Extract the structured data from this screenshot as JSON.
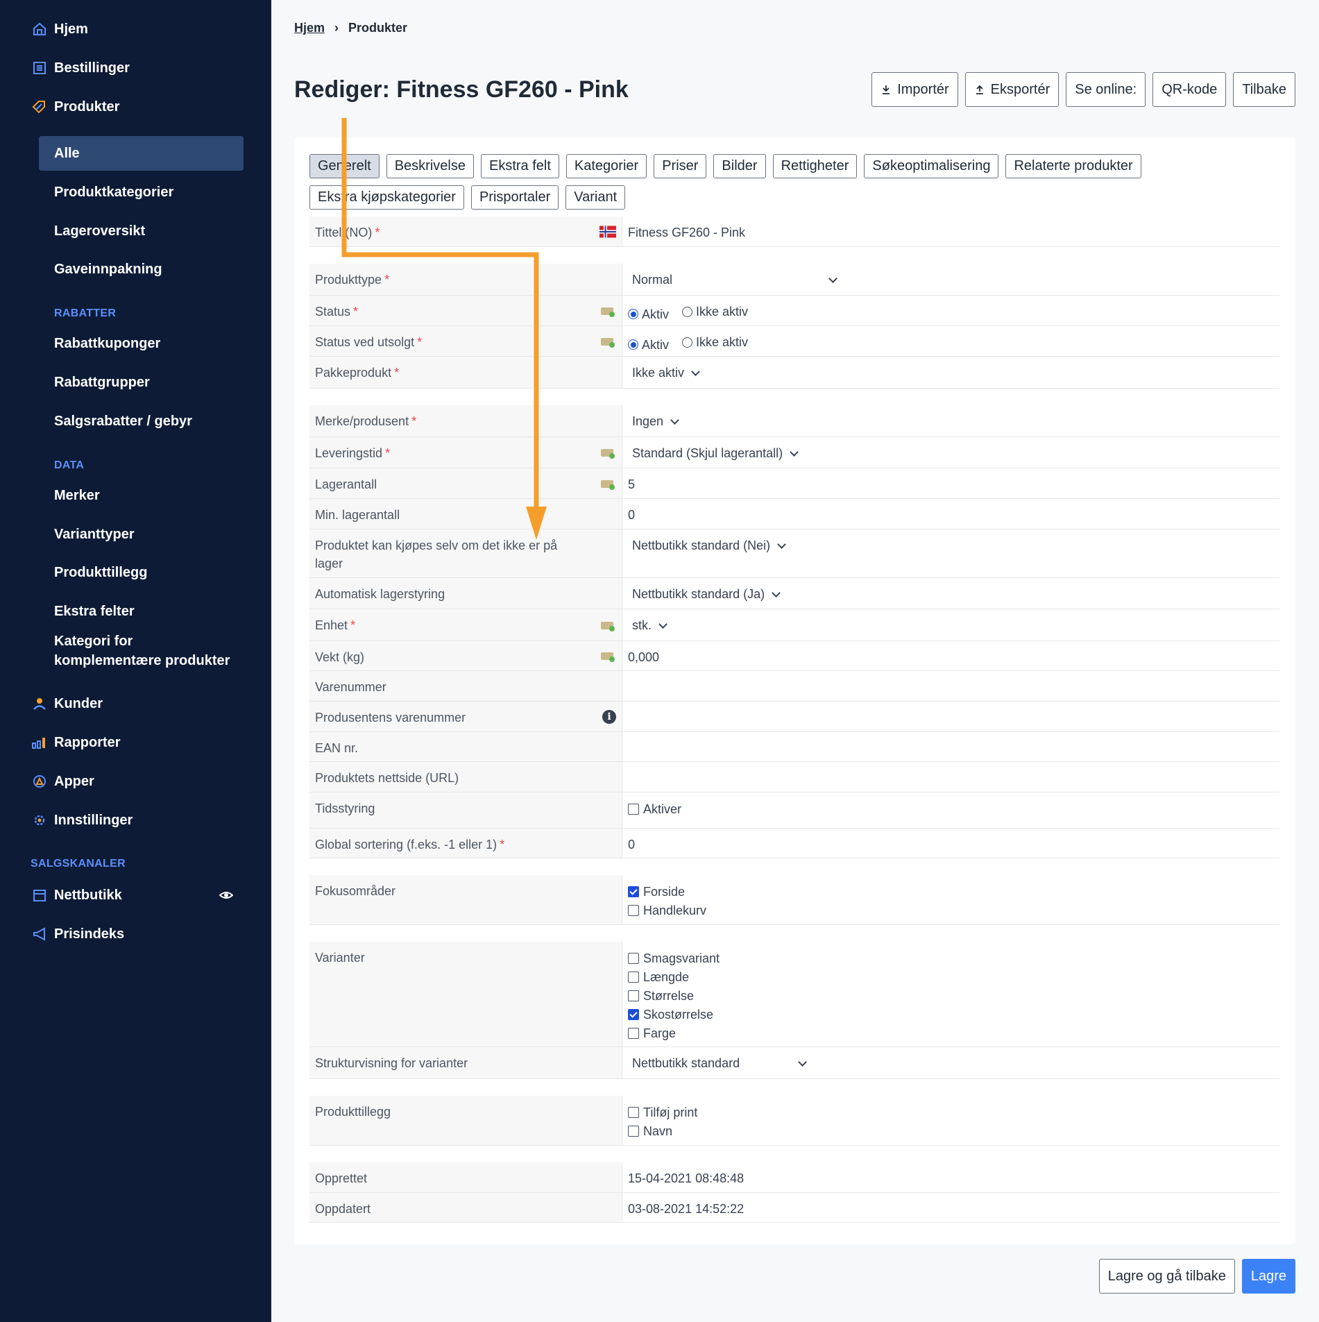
{
  "sidebar": {
    "top": [
      {
        "label": "Hjem",
        "icon": "home-icon"
      },
      {
        "label": "Bestillinger",
        "icon": "orders-icon"
      },
      {
        "label": "Produkter",
        "icon": "tag-icon"
      }
    ],
    "products_sub": [
      "Alle",
      "Produktkategorier",
      "Lageroversikt",
      "Gaveinnpakning"
    ],
    "section_rabatter": "RABATTER",
    "rabatter": [
      "Rabattkuponger",
      "Rabattgrupper",
      "Salgsrabatter / gebyr"
    ],
    "section_data": "DATA",
    "data_items": [
      "Merker",
      "Varianttyper",
      "Produkttillegg",
      "Ekstra felter",
      "Kategori for",
      "komplementære produkter"
    ],
    "bottom": [
      {
        "label": "Kunder",
        "icon": "user-icon"
      },
      {
        "label": "Rapporter",
        "icon": "chart-icon"
      },
      {
        "label": "Apper",
        "icon": "apps-icon"
      },
      {
        "label": "Innstillinger",
        "icon": "gear-icon"
      }
    ],
    "section_salgskanaler": "SALGSKANALER",
    "channels": [
      {
        "label": "Nettbutikk",
        "icon": "store-icon"
      },
      {
        "label": "Prisindeks",
        "icon": "megaphone-icon"
      }
    ]
  },
  "breadcrumb": {
    "home": "Hjem",
    "separator": "›",
    "current": "Produkter"
  },
  "title": "Rediger: Fitness GF260 - Pink",
  "actions": {
    "import": "Importér",
    "export": "Eksportér",
    "online": "Se online:",
    "qr": "QR-kode",
    "back": "Tilbake"
  },
  "tabs_row1": [
    "Generelt",
    "Beskrivelse",
    "Ekstra felt",
    "Kategorier",
    "Priser",
    "Bilder",
    "Rettigheter",
    "Søkeoptimalisering",
    "Relaterte produkter"
  ],
  "tabs_row2": [
    "Ekstra kjøpskategorier",
    "Prisportaler",
    "Variant"
  ],
  "form": {
    "tittel": {
      "label": "Tittel (NO)",
      "value": "Fitness GF260 - Pink"
    },
    "produkttype": {
      "label": "Produkttype",
      "value": "Normal"
    },
    "status": {
      "label": "Status",
      "on": "Aktiv",
      "off": "Ikke aktiv"
    },
    "status_utsolgt": {
      "label": "Status ved utsolgt",
      "on": "Aktiv",
      "off": "Ikke aktiv"
    },
    "pakkeprodukt": {
      "label": "Pakkeprodukt",
      "value": "Ikke aktiv"
    },
    "merke": {
      "label": "Merke/produsent",
      "value": "Ingen"
    },
    "leveringstid": {
      "label": "Leveringstid",
      "value": "Standard (Skjul lagerantall)"
    },
    "lagerantall": {
      "label": "Lagerantall",
      "value": "5"
    },
    "min_lager": {
      "label": "Min. lagerantall",
      "value": "0"
    },
    "kjopes": {
      "label": "Produktet kan kjøpes selv om det ikke er på lager",
      "value": "Nettbutikk standard (Nei)"
    },
    "auto_lager": {
      "label": "Automatisk lagerstyring",
      "value": "Nettbutikk standard (Ja)"
    },
    "enhet": {
      "label": "Enhet",
      "value": "stk."
    },
    "vekt": {
      "label": "Vekt (kg)",
      "value": "0,000"
    },
    "varenummer": {
      "label": "Varenummer",
      "value": ""
    },
    "prod_varenummer": {
      "label": "Produsentens varenummer",
      "value": ""
    },
    "ean": {
      "label": "EAN nr.",
      "value": ""
    },
    "url": {
      "label": "Produktets nettside (URL)",
      "value": ""
    },
    "tidsstyring": {
      "label": "Tidsstyring",
      "option": "Aktiver"
    },
    "sortering": {
      "label": "Global sortering (f.eks. -1 eller 1)",
      "value": "0"
    },
    "fokus": {
      "label": "Fokusområder",
      "options": [
        "Forside",
        "Handlekurv"
      ]
    },
    "varianter": {
      "label": "Varianter",
      "options": [
        "Smagsvariant",
        "Længde",
        "Størrelse",
        "Skostørrelse",
        "Farge"
      ]
    },
    "strukturvisning": {
      "label": "Strukturvisning for varianter",
      "value": "Nettbutikk standard"
    },
    "produkttillegg": {
      "label": "Produkttillegg",
      "options": [
        "Tilføj print",
        "Navn"
      ]
    },
    "opprettet": {
      "label": "Opprettet",
      "value": "15-04-2021 08:48:48"
    },
    "oppdatert": {
      "label": "Oppdatert",
      "value": "03-08-2021 14:52:22"
    }
  },
  "required_mark": "*",
  "info_mark": "i",
  "footer": {
    "save_back": "Lagre og gå tilbake",
    "save": "Lagre"
  },
  "colors": {
    "sidebar_bg": "#0d1b36",
    "active_item": "#2d4873",
    "accent": "#3b82f6",
    "arrow": "#f59e2c"
  }
}
